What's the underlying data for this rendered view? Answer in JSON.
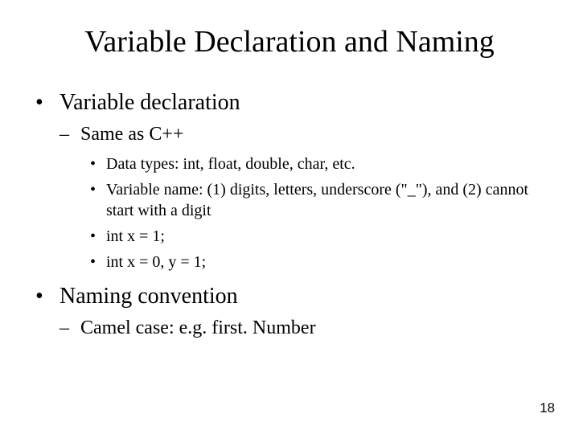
{
  "title": "Variable Declaration and Naming",
  "sections": [
    {
      "text": "Variable declaration",
      "subs": [
        {
          "text": "Same as C++",
          "items": [
            "Data types: int, float, double, char, etc.",
            "Variable name: (1) digits, letters, underscore (\"_\"), and (2) cannot start with a digit",
            "int x = 1;",
            "int x = 0, y = 1;"
          ]
        }
      ]
    },
    {
      "text": "Naming convention",
      "subs": [
        {
          "text": "Camel case: e.g. first. Number",
          "items": []
        }
      ]
    }
  ],
  "pageNumber": "18"
}
